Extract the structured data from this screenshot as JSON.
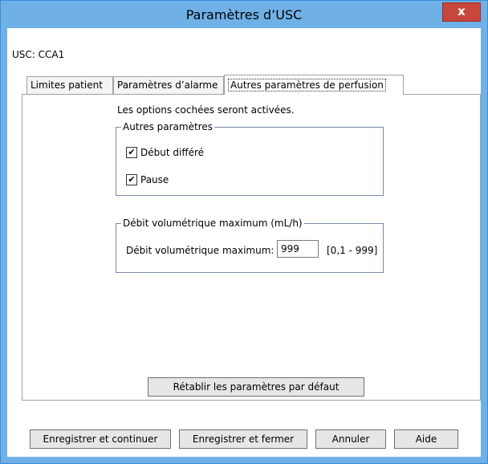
{
  "window": {
    "title": "Paramètres d’USC",
    "close_label": "x"
  },
  "usc": {
    "label": "USC: CCA1"
  },
  "tabs": [
    {
      "label": "Limites patient"
    },
    {
      "label": "Paramètres d’alarme"
    },
    {
      "label": "Autres paramètres de perfusion"
    }
  ],
  "panel": {
    "info_text": "Les options cochées seront activées.",
    "other_params": {
      "legend": "Autres paramètres",
      "items": [
        {
          "label": "Début différé",
          "checked": true,
          "check_glyph": "✔"
        },
        {
          "label": "Pause",
          "checked": true,
          "check_glyph": "✔"
        }
      ]
    },
    "max_flow": {
      "legend": "Débit volumétrique maximum (mL/h)",
      "label": "Débit volumétrique maximum:",
      "value": "999",
      "range": "[0,1 - 999]"
    },
    "restore_label": "Rétablir les paramètres par défaut"
  },
  "buttons": {
    "save_continue": "Enregistrer et continuer",
    "save_close": "Enregistrer et fermer",
    "cancel": "Annuler",
    "help": "Aide"
  }
}
